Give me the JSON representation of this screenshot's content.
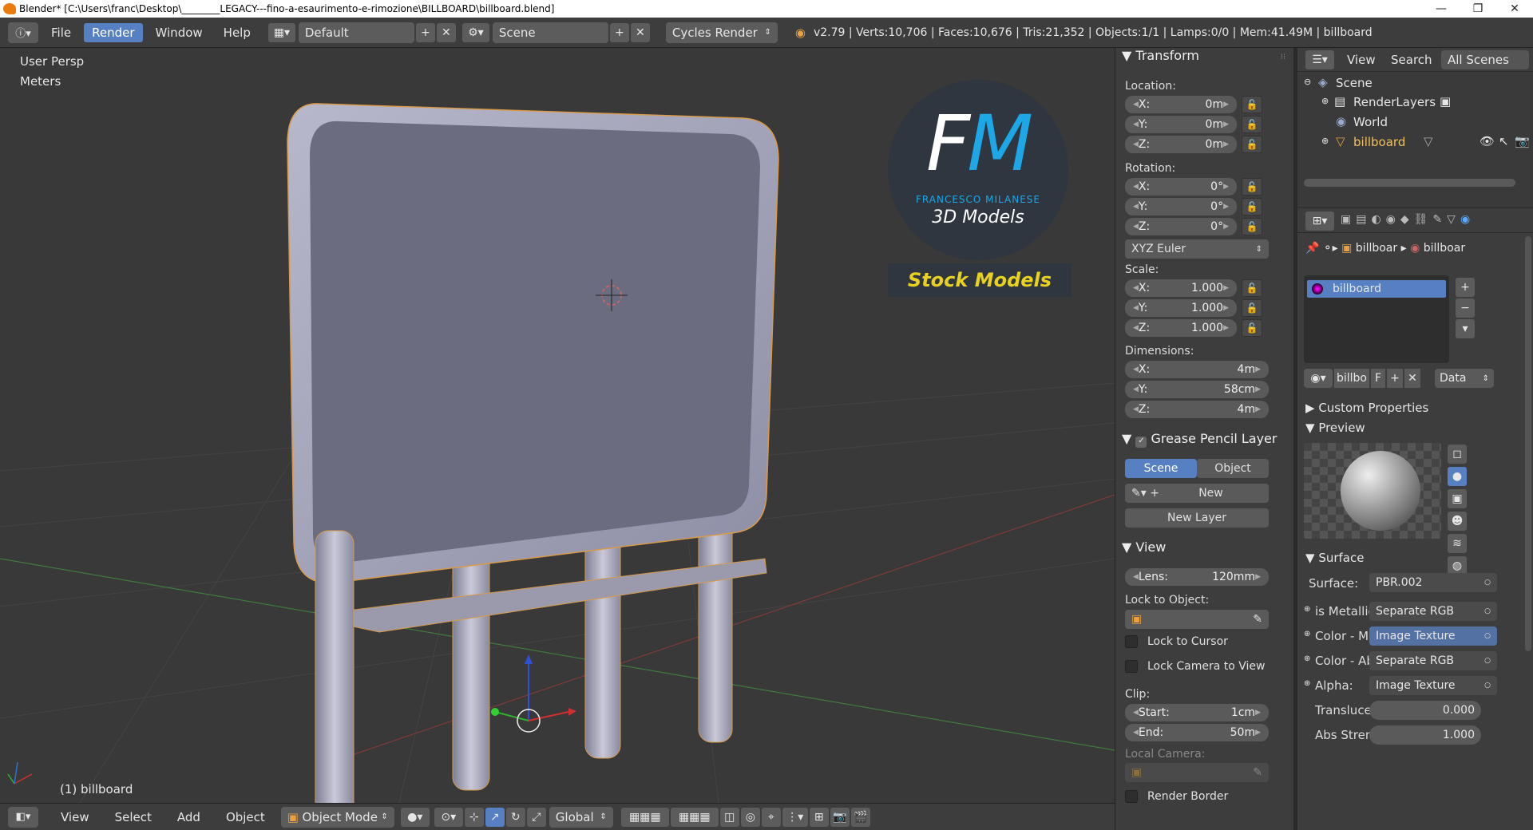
{
  "window": {
    "title": "Blender* [C:\\Users\\franc\\Desktop\\________LEGACY---fino-a-esaurimento-e-rimozione\\BILLBOARD\\billboard.blend]"
  },
  "topbar": {
    "menus": [
      "File",
      "Render",
      "Window",
      "Help"
    ],
    "active_menu": "Render",
    "layout": "Default",
    "scene": "Scene",
    "engine": "Cycles Render",
    "stats": "v2.79 | Verts:10,706 | Faces:10,676 | Tris:21,352 | Objects:1/1 | Lamps:0/0 | Mem:41.49M | billboard"
  },
  "viewport": {
    "view_name": "User Persp",
    "units": "Meters",
    "object_label": "(1) billboard",
    "logo": {
      "initials": "FM",
      "name": "FRANCESCO MILANESE",
      "tagline": "3D Models",
      "banner": "Stock Models"
    }
  },
  "viewbar": {
    "menus": [
      "View",
      "Select",
      "Add",
      "Object"
    ],
    "mode": "Object Mode",
    "orientation": "Global"
  },
  "transform": {
    "title": "Transform",
    "location_label": "Location:",
    "location": [
      {
        "axis": "X:",
        "value": "0m"
      },
      {
        "axis": "Y:",
        "value": "0m"
      },
      {
        "axis": "Z:",
        "value": "0m"
      }
    ],
    "rotation_label": "Rotation:",
    "rotation": [
      {
        "axis": "X:",
        "value": "0°"
      },
      {
        "axis": "Y:",
        "value": "0°"
      },
      {
        "axis": "Z:",
        "value": "0°"
      }
    ],
    "rotation_mode": "XYZ Euler",
    "scale_label": "Scale:",
    "scale": [
      {
        "axis": "X:",
        "value": "1.000"
      },
      {
        "axis": "Y:",
        "value": "1.000"
      },
      {
        "axis": "Z:",
        "value": "1.000"
      }
    ],
    "dimensions_label": "Dimensions:",
    "dimensions": [
      {
        "axis": "X:",
        "value": "4m"
      },
      {
        "axis": "Y:",
        "value": "58cm"
      },
      {
        "axis": "Z:",
        "value": "4m"
      }
    ]
  },
  "grease": {
    "title": "Grease Pencil Layer",
    "tab_scene": "Scene",
    "tab_object": "Object",
    "new_label": "New",
    "new_layer_label": "New Layer"
  },
  "view_panel": {
    "title": "View",
    "lens_label": "Lens:",
    "lens_value": "120mm",
    "lock_object_label": "Lock to Object:",
    "lock_cursor_label": "Lock to Cursor",
    "lock_camera_label": "Lock Camera to View",
    "clip_label": "Clip:",
    "clip_start_label": "Start:",
    "clip_start": "1cm",
    "clip_end_label": "End:",
    "clip_end": "50m",
    "local_camera_label": "Local Camera:",
    "render_border_label": "Render Border"
  },
  "outliner": {
    "menus": [
      "View",
      "Search"
    ],
    "filter": "All Scenes",
    "items": [
      "Scene",
      "RenderLayers",
      "World",
      "billboard"
    ]
  },
  "properties": {
    "breadcrumb": [
      "billboar",
      "billboar"
    ],
    "material_slot": "billboard",
    "material_name": "billbo",
    "fake_user": "F",
    "link": "Data",
    "custom_props": "Custom Properties",
    "preview": "Preview",
    "surface_title": "Surface",
    "surface_label": "Surface:",
    "surface_value": "PBR.002",
    "inputs": [
      {
        "label": "is Metallic",
        "value": "Separate RGB",
        "hi": false
      },
      {
        "label": "Color - Ma",
        "value": "Image Texture",
        "hi": true
      },
      {
        "label": "Color - Ab",
        "value": "Separate RGB",
        "hi": false
      },
      {
        "label": "Alpha:",
        "value": "Image Texture",
        "hi": false
      }
    ],
    "translucency_label": "Transluce",
    "translucency_value": "0.000",
    "abs_label": "Abs Stren",
    "abs_value": "1.000"
  }
}
